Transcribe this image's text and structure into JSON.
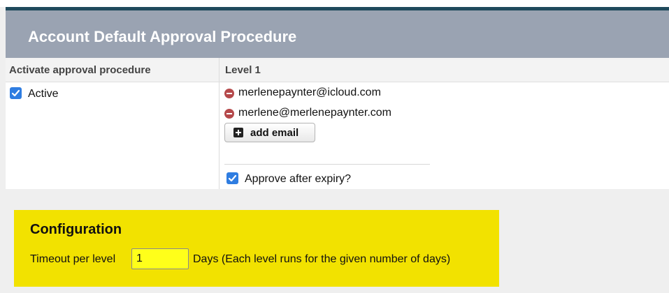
{
  "panel": {
    "title": "Account Default Approval Procedure"
  },
  "table": {
    "headers": [
      "Activate approval procedure",
      "Level 1"
    ],
    "active_label": "Active",
    "active_checked": true,
    "emails": [
      "merlenepaynter@icloud.com",
      "merlene@merlenepaynter.com"
    ],
    "add_email_label": "add email",
    "approve_after_expiry_label": "Approve after expiry?",
    "approve_after_expiry_checked": true
  },
  "configuration": {
    "title": "Configuration",
    "timeout_label": "Timeout per level",
    "timeout_value": "1",
    "timeout_suffix": "Days (Each level runs for the given number of days)"
  },
  "colors": {
    "header_bar": "#9aa3b2",
    "top_accent": "#1f4a5c",
    "checkbox": "#2f7de1",
    "remove_icon": "#b5494b",
    "config_background": "#f2e200",
    "input_background": "#ffff1a"
  },
  "icons": {
    "remove": "minus-circle-icon",
    "add": "plus-square-icon",
    "check": "checkmark-icon"
  }
}
